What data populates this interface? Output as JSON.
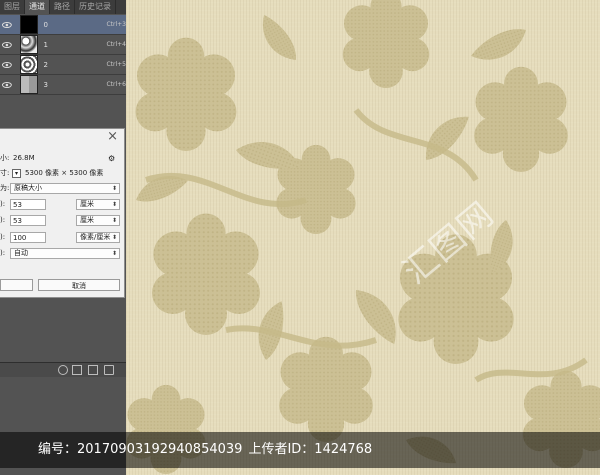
{
  "channels_panel": {
    "tabs": [
      {
        "label": "图层"
      },
      {
        "label": "通道"
      },
      {
        "label": "路径"
      },
      {
        "label": "历史记录"
      }
    ],
    "channels": [
      {
        "name": "0",
        "shortcut": "Ctrl+3"
      },
      {
        "name": "1",
        "shortcut": "Ctrl+4"
      },
      {
        "name": "2",
        "shortcut": "Ctrl+5"
      },
      {
        "name": "3",
        "shortcut": "Ctrl+6"
      }
    ]
  },
  "dialog": {
    "close_label": "×",
    "size_label": "小:",
    "size_value": "26.8M",
    "dimensions_label": "寸:",
    "dimensions_value": "5300 像素 × 5300 像素",
    "fit_label": "为:",
    "fit_value": "原稿大小",
    "width_label": "):",
    "width_value": "53",
    "width_unit": "厘米",
    "height_label": "):",
    "height_value": "53",
    "height_unit": "厘米",
    "resolution_label": "):",
    "resolution_value": "100",
    "resolution_unit": "像素/厘米",
    "resample_label": "):",
    "resample_value": "自动",
    "cancel_label": "取消",
    "ok_label": ""
  },
  "watermark": {
    "text": "汇图网"
  },
  "info_bar": {
    "number_label": "编号：",
    "number_value": "20170903192940854039",
    "uploader_label": "上传者ID：",
    "uploader_value": "1424768"
  },
  "colors": {
    "canvas_bg": "#e6ddbd",
    "pattern": "#c8bc90",
    "selected_row": "#5b6a85"
  }
}
